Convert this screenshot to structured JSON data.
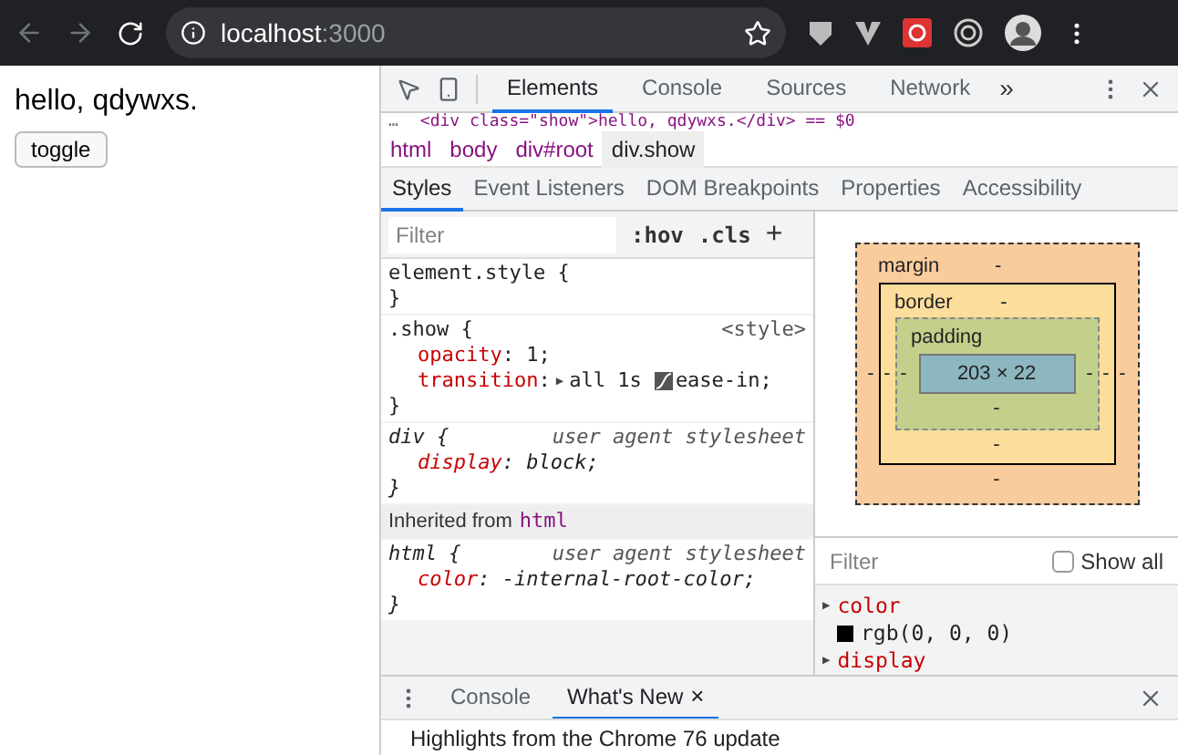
{
  "browser": {
    "url_host": "localhost",
    "url_port": ":3000"
  },
  "page": {
    "text": "hello, qdywxs.",
    "button": "toggle"
  },
  "devtools": {
    "tabs": [
      {
        "label": "Elements",
        "selected": true
      },
      {
        "label": "Console",
        "selected": false
      },
      {
        "label": "Sources",
        "selected": false
      },
      {
        "label": "Network",
        "selected": false
      }
    ],
    "more": "»",
    "dom_line": {
      "prefix": "…",
      "code": "<div class=\"show\">hello, qdywxs.</div> == $0"
    },
    "breadcrumbs": [
      {
        "label": "html",
        "selected": false
      },
      {
        "label": "body",
        "selected": false
      },
      {
        "label": "div#root",
        "selected": false
      },
      {
        "label": "div.show",
        "selected": true
      }
    ],
    "subtabs": [
      {
        "label": "Styles",
        "selected": true
      },
      {
        "label": "Event Listeners",
        "selected": false
      },
      {
        "label": "DOM Breakpoints",
        "selected": false
      },
      {
        "label": "Properties",
        "selected": false
      },
      {
        "label": "Accessibility",
        "selected": false
      }
    ],
    "filter": {
      "placeholder": "Filter",
      "hov": ":hov",
      "cls": ".cls",
      "plus": "+"
    },
    "rules": [
      {
        "kind": "rule",
        "selector": "element.style {",
        "italic": false,
        "close": "}"
      },
      {
        "kind": "rule",
        "selector": ".show {",
        "source": "<style>",
        "italic": false,
        "props": [
          {
            "name": "opacity",
            "sep": ":",
            "value": "1;"
          },
          {
            "name": "transition",
            "sep": ":",
            "value": "all 1s ",
            "expander": "▶",
            "easing": "ease-in;"
          }
        ],
        "close": "}"
      },
      {
        "kind": "rule",
        "selector": "div {",
        "source": "user agent stylesheet",
        "italic": true,
        "props": [
          {
            "name": "display",
            "sep": ":",
            "value": "block;"
          }
        ],
        "close": "}"
      },
      {
        "kind": "inherited",
        "label": "Inherited from",
        "tag": "html"
      },
      {
        "kind": "rule",
        "selector": "html {",
        "source": "user agent stylesheet",
        "italic": true,
        "props": [
          {
            "name": "color",
            "sep": ":",
            "value": "-internal-root-color;"
          }
        ],
        "close": "}"
      }
    ],
    "box_model": {
      "margin": "margin",
      "margin_val": "-",
      "border": "border",
      "border_val": "-",
      "padding": "padding",
      "padding_val": "-",
      "content": "203 × 22",
      "dash": "-"
    },
    "computed": {
      "filter_placeholder": "Filter",
      "show_all": {
        "label": "Show all",
        "checked": false
      },
      "props": [
        {
          "expander": "▶",
          "name": "color",
          "value": "rgb(0, 0, 0)",
          "color": "#000000"
        },
        {
          "expander": "▶",
          "name": "display"
        }
      ]
    },
    "drawer": {
      "tabs": [
        {
          "label": "Console",
          "selected": false,
          "closable": false
        },
        {
          "label": "What's New",
          "selected": true,
          "closable": true
        }
      ],
      "close_tab": "×",
      "content": "Highlights from the Chrome 76 update"
    }
  }
}
